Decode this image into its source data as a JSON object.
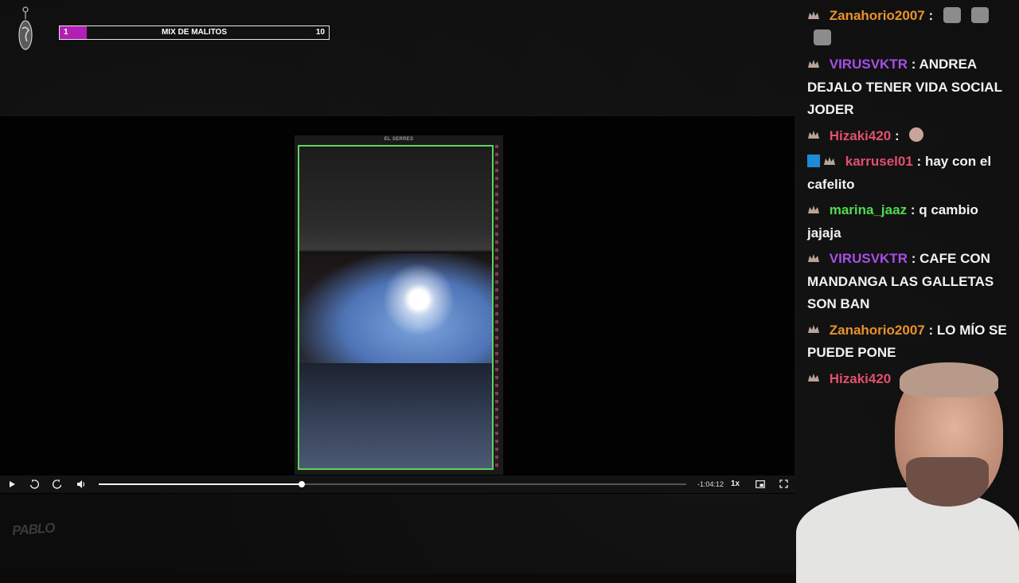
{
  "goal": {
    "start": "1",
    "label": "MIX DE MALITOS",
    "end": "10",
    "progress_fraction": 0.1,
    "fill_color": "#b21fb3"
  },
  "phone": {
    "name": "EL SERRES"
  },
  "player": {
    "time_remaining": "-1:04:12",
    "speed": "1x",
    "progress_fraction": 0.345,
    "controls": [
      "play-icon",
      "rewind-icon",
      "forward-icon",
      "volume-icon",
      "pip-icon",
      "fullscreen-icon"
    ]
  },
  "brand": {
    "text": "PABLO"
  },
  "chat": {
    "messages": [
      {
        "user": "Zanahorio2007",
        "color": "#e8922a",
        "text": "",
        "emotes": 3
      },
      {
        "user": "VIRUSVKTR",
        "color": "#a74fe6",
        "text": "ANDREA DEJALO TENER VIDA SOCIAL JODER"
      },
      {
        "user": "Hizaki420",
        "color": "#e2506d",
        "text": "",
        "emotes": 1
      },
      {
        "user": "karrusel01",
        "color": "#e2506d",
        "text": "hay con el cafelito",
        "sub": true
      },
      {
        "user": "marina_jaaz",
        "color": "#4fdc4f",
        "text": "q cambio jajaja"
      },
      {
        "user": "VIRUSVKTR",
        "color": "#a74fe6",
        "text": "CAFE CON MANDANGA LAS GALLETAS SON BAN"
      },
      {
        "user": "Zanahorio2007",
        "color": "#e8922a",
        "text": "LO MÍO SE PUEDE PONE"
      },
      {
        "user": "Hizaki420",
        "color": "#e2506d",
        "text": ""
      }
    ]
  }
}
